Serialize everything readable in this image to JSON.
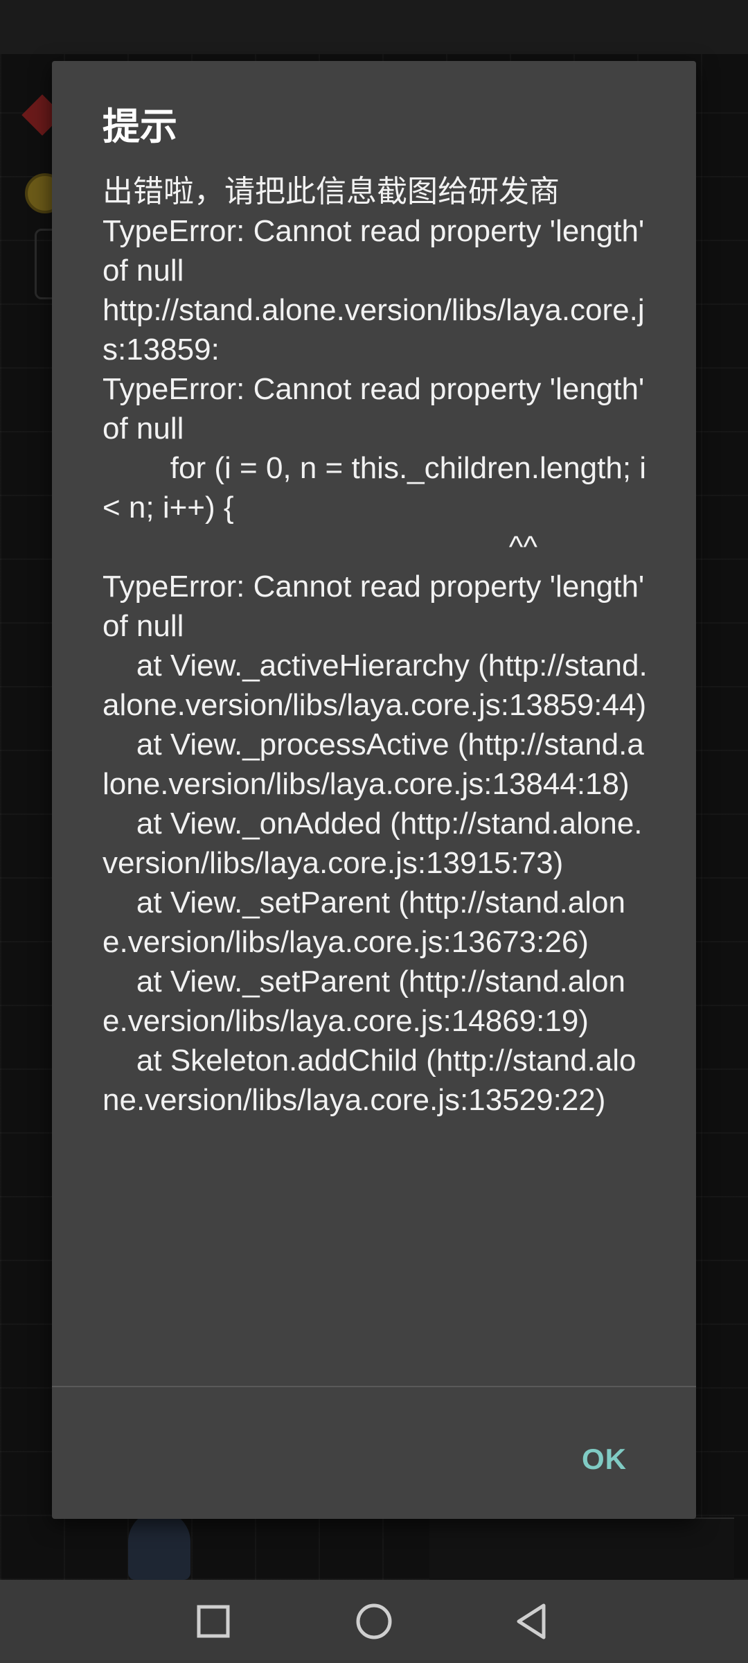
{
  "dialog": {
    "title": "提示",
    "message": "出错啦，请把此信息截图给研发商\nTypeError: Cannot read property 'length' of null\nhttp://stand.alone.version/libs/laya.core.js:13859:\nTypeError: Cannot read property 'length' of null\n        for (i = 0, n = this._children.length; i < n; i++) {\n                                                ^^\nTypeError: Cannot read property 'length' of null\n    at View._activeHierarchy (http://stand.alone.version/libs/laya.core.js:13859:44)\n    at View._processActive (http://stand.alone.version/libs/laya.core.js:13844:18)\n    at View._onAdded (http://stand.alone.version/libs/laya.core.js:13915:73)\n    at View._setParent (http://stand.alone.version/libs/laya.core.js:13673:26)\n    at View._setParent (http://stand.alone.version/libs/laya.core.js:14869:19)\n    at Skeleton.addChild (http://stand.alone.version/libs/laya.core.js:13529:22)",
    "ok_label": "OK",
    "accent_color": "#80cbc4",
    "background_color": "#424242"
  },
  "nav_bar": {
    "icons": [
      "square-recents-icon",
      "circle-home-icon",
      "triangle-back-icon"
    ]
  }
}
